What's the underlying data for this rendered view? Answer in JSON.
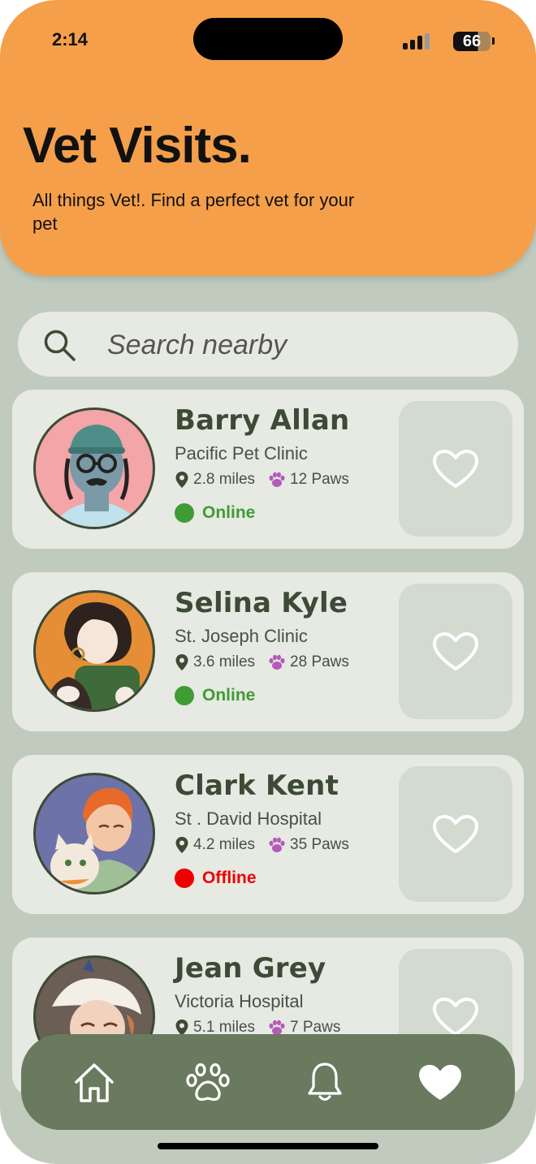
{
  "status_bar": {
    "time": "2:14",
    "battery": "66"
  },
  "header": {
    "title": "Vet Visits.",
    "subtitle": "All things Vet!. Find a perfect vet for your pet"
  },
  "search": {
    "placeholder": "Search nearby"
  },
  "vets": [
    {
      "name": "Barry Allan",
      "clinic": "Pacific Pet Clinic",
      "distance": "2.8 miles",
      "paws": "12 Paws",
      "status": "Online"
    },
    {
      "name": "Selina Kyle",
      "clinic": "St. Joseph Clinic",
      "distance": "3.6 miles",
      "paws": "28 Paws",
      "status": "Online"
    },
    {
      "name": "Clark Kent",
      "clinic": "St . David Hospital",
      "distance": "4.2 miles",
      "paws": "35 Paws",
      "status": "Offline"
    },
    {
      "name": "Jean Grey",
      "clinic": "Victoria Hospital",
      "distance": "5.1 miles",
      "paws": "7 Paws",
      "status": ""
    }
  ],
  "colors": {
    "header": "#f59f4a",
    "background": "#c1cbbd",
    "card": "#e7e9e3",
    "online": "#3f9c35",
    "offline": "#ee0000",
    "navbar": "#697a5f",
    "paw": "#b45ab8"
  },
  "nav": [
    "home-icon",
    "paw-icon",
    "bell-icon",
    "heart-icon"
  ]
}
